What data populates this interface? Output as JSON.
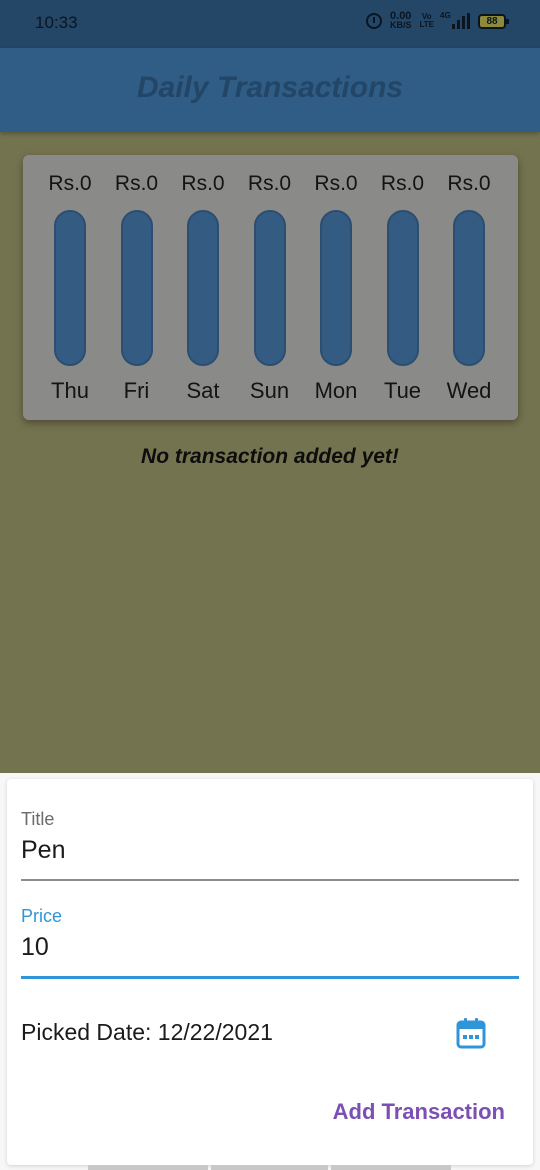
{
  "status_bar": {
    "time": "10:33",
    "speed_value": "0.00",
    "speed_unit": "KB/S",
    "volte_top": "Vo",
    "volte_bottom": "LTE",
    "network": "4G",
    "battery": "88"
  },
  "app_bar": {
    "title": "Daily Transactions"
  },
  "chart_data": {
    "type": "bar",
    "categories": [
      "Thu",
      "Fri",
      "Sat",
      "Sun",
      "Mon",
      "Tue",
      "Wed"
    ],
    "values": [
      0,
      0,
      0,
      0,
      0,
      0,
      0
    ],
    "labels": [
      "Rs.0",
      "Rs.0",
      "Rs.0",
      "Rs.0",
      "Rs.0",
      "Rs.0",
      "Rs.0"
    ],
    "ylim": [
      0,
      1
    ],
    "colors": {
      "track": "#345b82",
      "fill": "#6a1f83"
    }
  },
  "empty_message": "No transaction added yet!",
  "form": {
    "title_label": "Title",
    "title_value": "Pen",
    "price_label": "Price",
    "price_value": "10",
    "date_text": "Picked Date: 12/22/2021",
    "calendar_icon": "calendar-icon",
    "submit_label": "Add Transaction"
  },
  "colors": {
    "accent": "#2f95d9",
    "button": "#7b4fb4",
    "primary": "#2f5d86"
  }
}
